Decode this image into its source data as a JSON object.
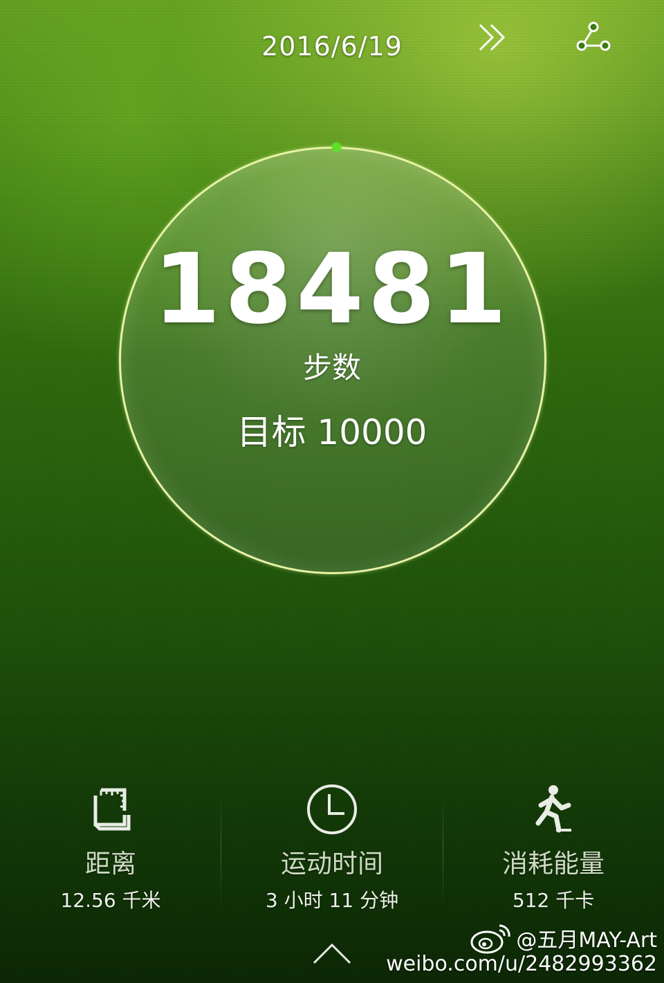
{
  "header": {
    "date": "2016/6/19",
    "forward_icon": "double-chevron-right-icon",
    "share_icon": "share-icon"
  },
  "progress": {
    "steps": "18481",
    "steps_label": "步数",
    "goal_text": "目标 10000",
    "ring_color": "#e7f3a7",
    "indicator_color": "#5de02a"
  },
  "stats": [
    {
      "icon": "ruler-distance-icon",
      "label": "距离",
      "value": "12.56 千米"
    },
    {
      "icon": "clock-icon",
      "label": "运动时间",
      "value": "3 小时 11 分钟"
    },
    {
      "icon": "running-person-icon",
      "label": "消耗能量",
      "value": "512 千卡"
    }
  ],
  "footer": {
    "expand_icon": "chevron-up-icon"
  },
  "watermark": {
    "logo": "weibo-logo",
    "handle": "@五月MAY-Art",
    "url": "weibo.com/u/2482993362"
  }
}
